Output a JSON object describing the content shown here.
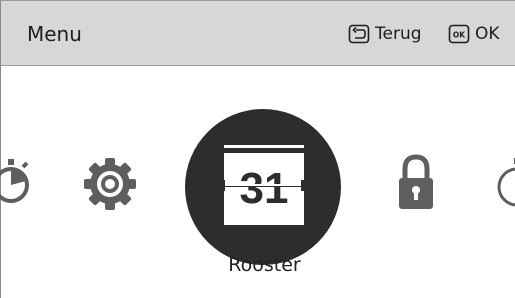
{
  "header": {
    "title": "Menu",
    "back_icon": "back-key-icon",
    "back_label": "Terug",
    "ok_icon": "ok-key-icon",
    "ok_icon_text": "OK",
    "ok_label": "OK"
  },
  "carousel": {
    "items": [
      {
        "icon": "timer-icon"
      },
      {
        "icon": "gear-icon"
      },
      {
        "icon": "calendar-icon",
        "icon_text": "31",
        "selected": true
      },
      {
        "icon": "lock-icon"
      },
      {
        "icon": "clock-icon"
      }
    ],
    "selected_label": "Rooster"
  },
  "colors": {
    "header_bg": "#d7d7d7",
    "icon_gray": "#5e5e5e",
    "selected_circle": "#2d2d2d",
    "text": "#222222"
  }
}
